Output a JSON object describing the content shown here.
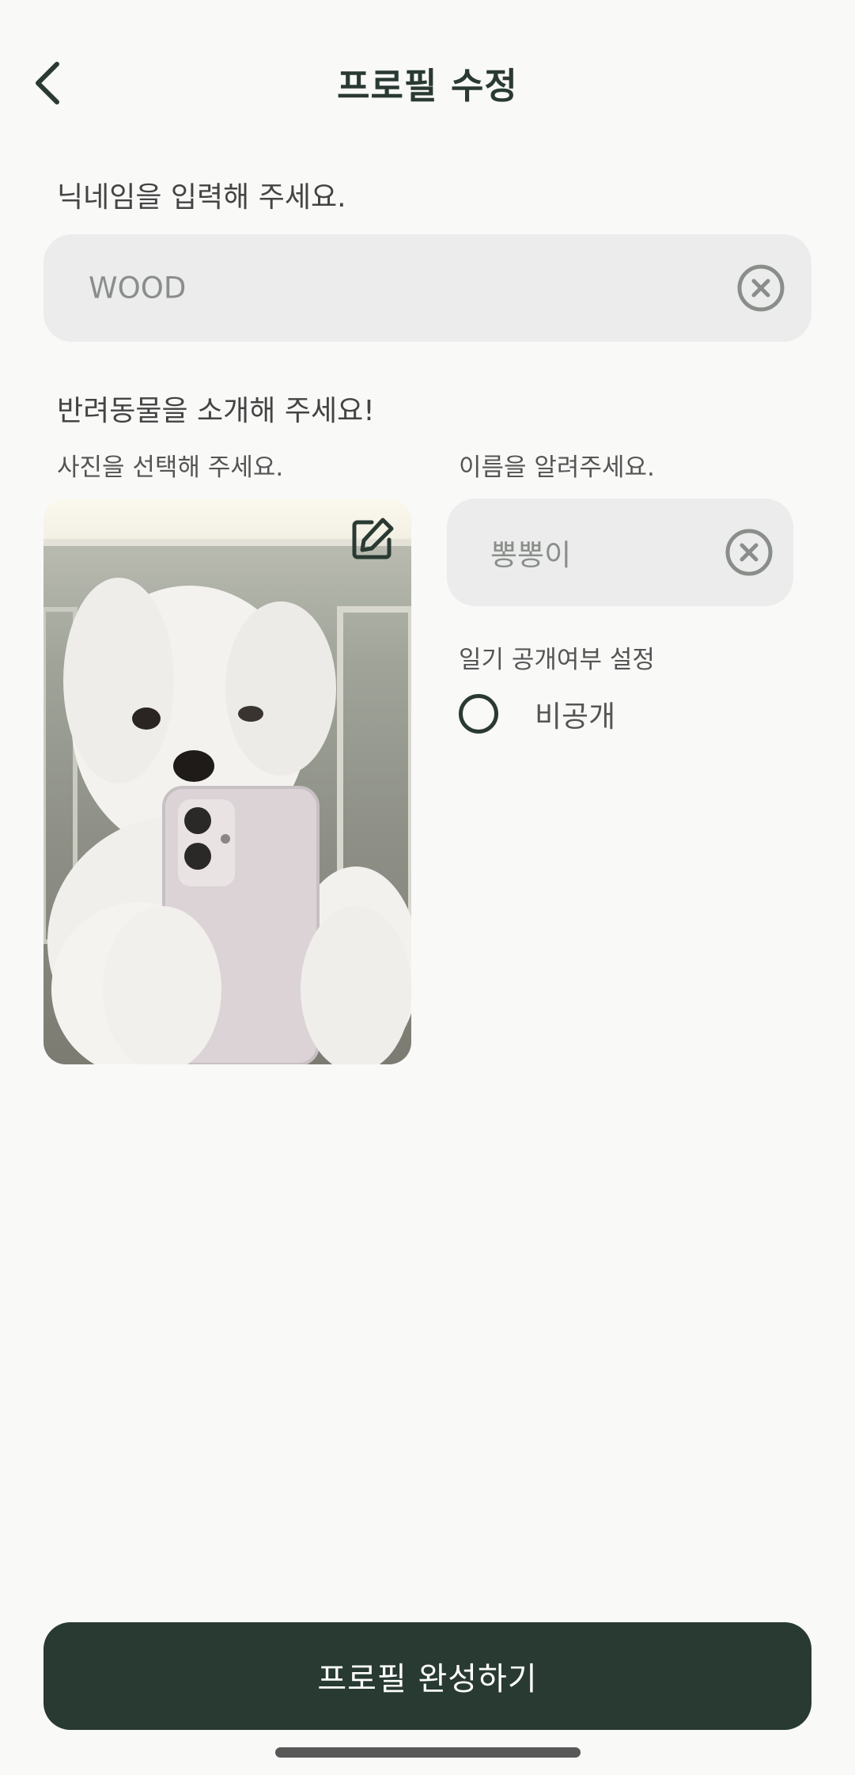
{
  "header": {
    "title": "프로필 수정",
    "back_icon": "chevron-left-icon"
  },
  "nickname": {
    "label": "닉네임을 입력해 주세요.",
    "value": "WOOD",
    "clear_icon": "clear-circle-icon"
  },
  "pet": {
    "section_label": "반려동물을 소개해 주세요!",
    "photo_label": "사진을 선택해 주세요.",
    "photo_edit_icon": "edit-icon",
    "name_label": "이름을 알려주세요.",
    "name_value": "뽕뽕이",
    "name_clear_icon": "clear-circle-icon",
    "diary_label": "일기 공개여부 설정",
    "private_option": "비공개",
    "private_selected": false
  },
  "footer": {
    "complete_label": "프로필 완성하기"
  },
  "colors": {
    "primary": "#283A32",
    "input_bg": "#EBECEB",
    "background": "#F9F9F8"
  }
}
